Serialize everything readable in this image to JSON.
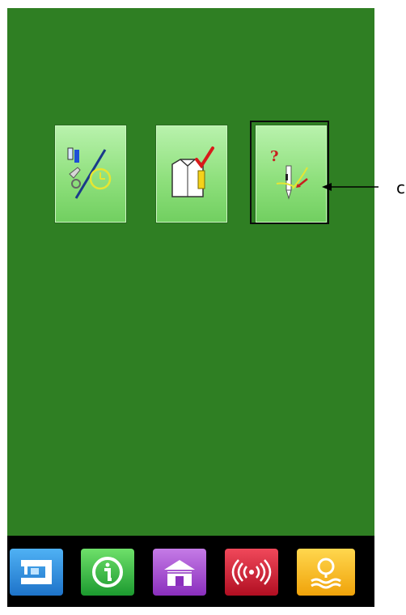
{
  "callout": {
    "label": "c"
  },
  "menu": {
    "buttons": [
      {
        "name": "maintenance",
        "icon": "maintenance-timer-icon"
      },
      {
        "name": "shirt-check",
        "icon": "shirt-check-icon"
      },
      {
        "name": "needle-check",
        "icon": "needle-question-icon",
        "selected": true
      }
    ]
  },
  "taskbar": [
    {
      "name": "sewing",
      "icon": "sewing-machine-icon",
      "color": "#1e73c9"
    },
    {
      "name": "info",
      "icon": "info-icon",
      "color": "#1c9a2f"
    },
    {
      "name": "home",
      "icon": "home-icon",
      "color": "#8a2fbd"
    },
    {
      "name": "communication",
      "icon": "wireless-icon",
      "color": "#b10f22"
    },
    {
      "name": "search",
      "icon": "magnifier-icon",
      "color": "#f0a30a"
    }
  ],
  "colors": {
    "background": "#2f7f23",
    "button": "#8fe07d"
  }
}
